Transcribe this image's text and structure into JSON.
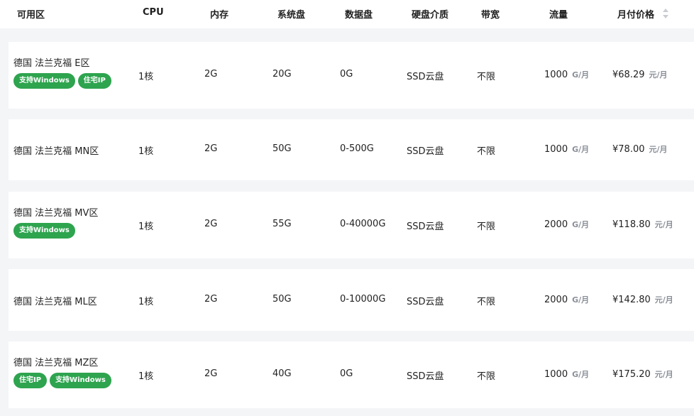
{
  "header": {
    "zone": "可用区",
    "cpu": "CPU",
    "mem": "内存",
    "sysdisk": "系统盘",
    "datadisk": "数据盘",
    "media": "硬盘介质",
    "bandwidth": "带宽",
    "traffic": "流量",
    "price": "月付价格"
  },
  "rows": [
    {
      "zone": "德国 法兰克福 E区",
      "tags": [
        "支持Windows",
        "住宅IP"
      ],
      "cpu": "1核",
      "mem": "2G",
      "sysdisk": "20G",
      "datadisk": "0G",
      "media": "SSD云盘",
      "bandwidth": "不限",
      "traffic": "1000",
      "traffic_unit": "G/月",
      "price": "¥68.29",
      "price_unit": "元/月"
    },
    {
      "zone": "德国 法兰克福 MN区",
      "tags": [],
      "cpu": "1核",
      "mem": "2G",
      "sysdisk": "50G",
      "datadisk": "0-500G",
      "media": "SSD云盘",
      "bandwidth": "不限",
      "traffic": "1000",
      "traffic_unit": "G/月",
      "price": "¥78.00",
      "price_unit": "元/月"
    },
    {
      "zone": "德国 法兰克福 MV区",
      "tags": [
        "支持Windows"
      ],
      "cpu": "1核",
      "mem": "2G",
      "sysdisk": "55G",
      "datadisk": "0-40000G",
      "media": "SSD云盘",
      "bandwidth": "不限",
      "traffic": "2000",
      "traffic_unit": "G/月",
      "price": "¥118.80",
      "price_unit": "元/月"
    },
    {
      "zone": "德国 法兰克福 ML区",
      "tags": [],
      "cpu": "1核",
      "mem": "2G",
      "sysdisk": "50G",
      "datadisk": "0-10000G",
      "media": "SSD云盘",
      "bandwidth": "不限",
      "traffic": "2000",
      "traffic_unit": "G/月",
      "price": "¥142.80",
      "price_unit": "元/月"
    },
    {
      "zone": "德国 法兰克福 MZ区",
      "tags": [
        "住宅IP",
        "支持Windows"
      ],
      "cpu": "1核",
      "mem": "2G",
      "sysdisk": "40G",
      "datadisk": "0G",
      "media": "SSD云盘",
      "bandwidth": "不限",
      "traffic": "1000",
      "traffic_unit": "G/月",
      "price": "¥175.20",
      "price_unit": "元/月"
    }
  ],
  "colors": {
    "tag": "#2ea44f",
    "unit": "#8a8f98",
    "background": "#f4f5f7"
  },
  "icons": {
    "sort": "sort-caret-icon"
  }
}
